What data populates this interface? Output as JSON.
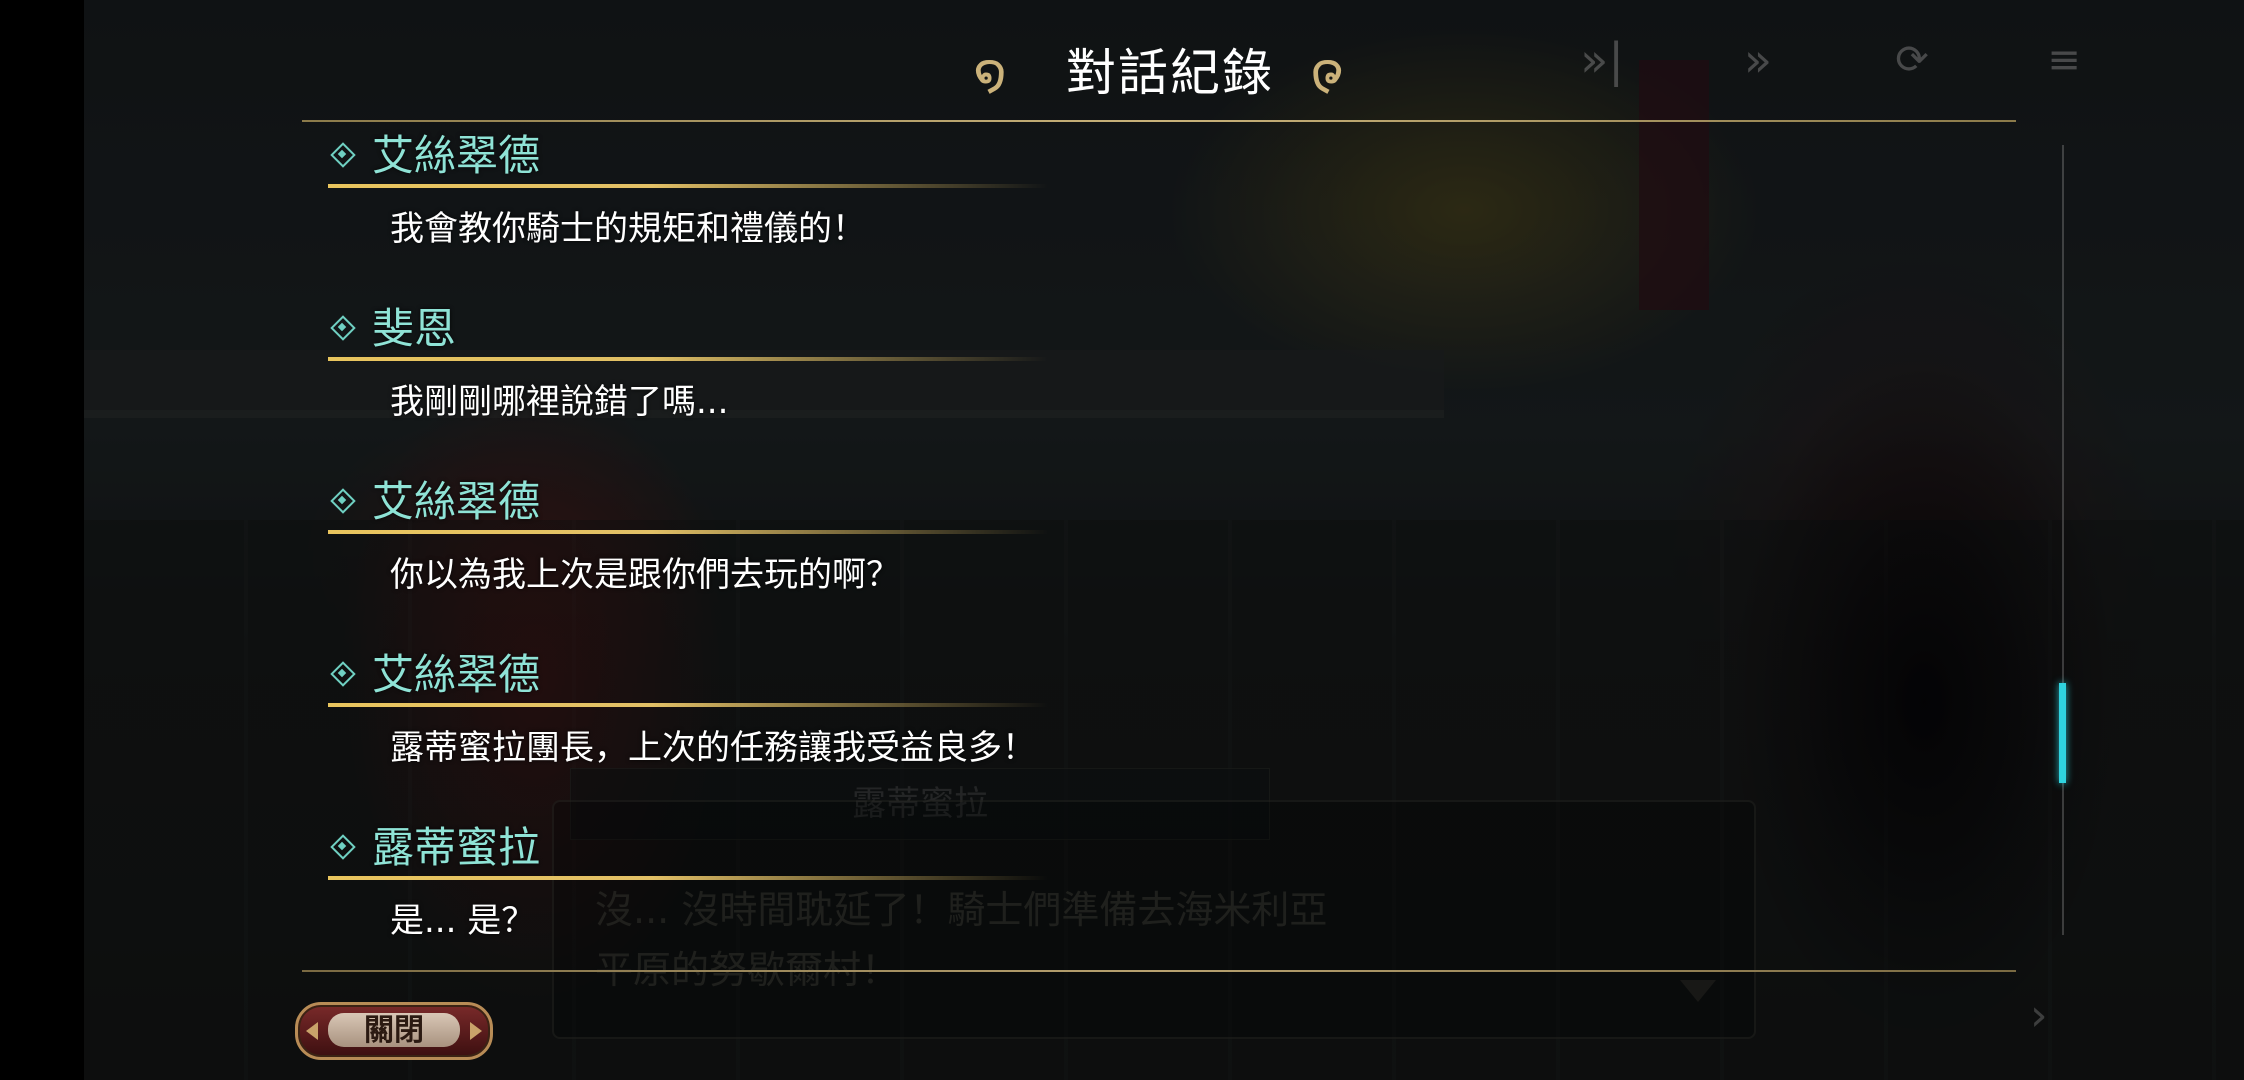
{
  "panel": {
    "title": "對話紀錄",
    "close_label": "關閉"
  },
  "entries": [
    {
      "speaker": "艾絲翠德",
      "text": "我會教你騎士的規矩和禮儀的！"
    },
    {
      "speaker": "斐恩",
      "text": "我剛剛哪裡說錯了嗎..."
    },
    {
      "speaker": "艾絲翠德",
      "text": "你以為我上次是跟你們去玩的啊？"
    },
    {
      "speaker": "艾絲翠德",
      "text": "露蒂蜜拉團長，上次的任務讓我受益良多！"
    },
    {
      "speaker": "露蒂蜜拉",
      "text": "是... 是？"
    }
  ],
  "background_dialogue": {
    "name": "露蒂蜜拉",
    "text": "沒... 沒時間耽延了！騎士們準備去海米利亞\n平原的努歇爾村！"
  },
  "controls": {
    "skip_icon": "fast-forward-skip-icon",
    "auto_icon": "auto-play-icon",
    "replay_icon": "replay-icon",
    "log_icon": "log-icon"
  },
  "colors": {
    "speaker": "#8fe3d6",
    "accent_gold": "#e2c066",
    "scroll_thumb": "#2fd3df"
  },
  "scroll": {
    "position_fraction": 0.78
  }
}
